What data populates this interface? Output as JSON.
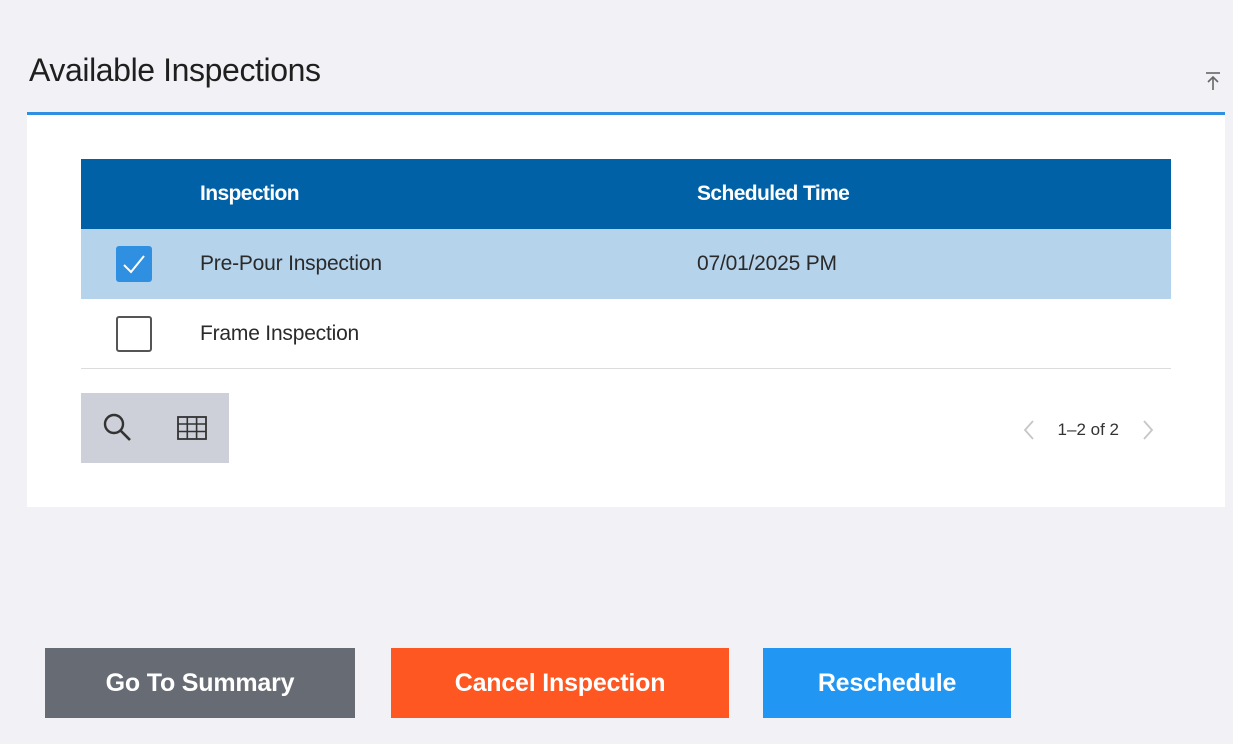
{
  "section": {
    "title": "Available Inspections",
    "collapse_icon": "collapse-up-icon"
  },
  "grid": {
    "columns": [
      "Inspection",
      "Scheduled Time"
    ],
    "rows": [
      {
        "selected": true,
        "inspection": "Pre-Pour Inspection",
        "scheduled_time": "07/01/2025 PM"
      },
      {
        "selected": false,
        "inspection": "Frame Inspection",
        "scheduled_time": ""
      }
    ]
  },
  "toolbar": {
    "search_icon": "search-icon",
    "columns_icon": "grid-columns-icon"
  },
  "pager": {
    "label": "1–2 of 2"
  },
  "actions": {
    "summary_label": "Go To Summary",
    "cancel_label": "Cancel Inspection",
    "reschedule_label": "Reschedule"
  },
  "colors": {
    "accent": "#2f8fe0",
    "header_bg": "#0061a6",
    "selected_row": "#b6d3ec",
    "summary_btn": "#676b73",
    "cancel_btn": "#ff5722",
    "reschedule_btn": "#2196f3"
  }
}
